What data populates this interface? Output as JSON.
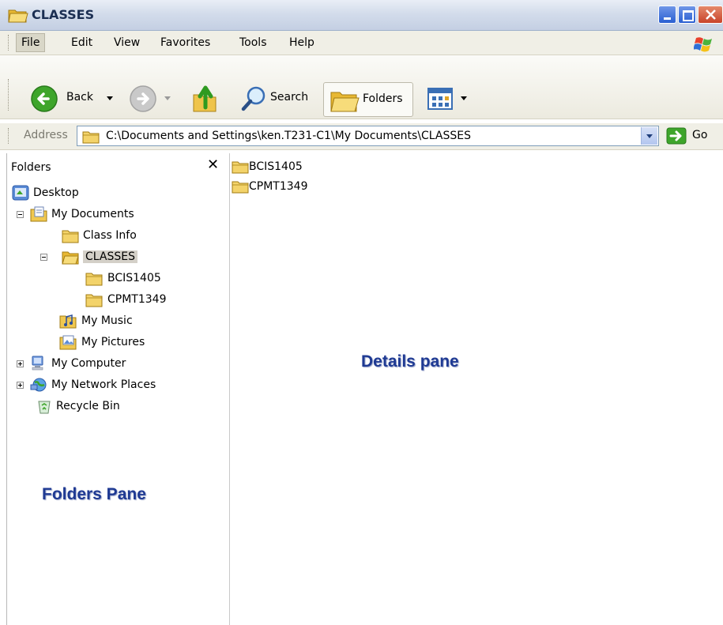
{
  "window": {
    "title": "CLASSES"
  },
  "menubar": {
    "items": [
      "File",
      "Edit",
      "View",
      "Favorites",
      "Tools",
      "Help"
    ]
  },
  "toolbar": {
    "back_label": "Back",
    "search_label": "Search",
    "folders_label": "Folders"
  },
  "address": {
    "label": "Address",
    "value": "C:\\Documents and Settings\\ken.T231-C1\\My Documents\\CLASSES",
    "go_label": "Go"
  },
  "folders_pane": {
    "header": "Folders",
    "items": [
      {
        "label": "Desktop",
        "icon": "desktop-icon"
      },
      {
        "label": "My Documents",
        "icon": "my-documents-icon",
        "expander": "minus"
      },
      {
        "label": "Class Info",
        "icon": "folder-icon"
      },
      {
        "label": "CLASSES",
        "icon": "folder-open-icon",
        "expander": "minus",
        "selected": true
      },
      {
        "label": "BCIS1405",
        "icon": "folder-icon"
      },
      {
        "label": "CPMT1349",
        "icon": "folder-icon"
      },
      {
        "label": "My Music",
        "icon": "music-folder-icon"
      },
      {
        "label": "My Pictures",
        "icon": "pictures-folder-icon"
      },
      {
        "label": "My Computer",
        "icon": "computer-icon",
        "expander": "plus"
      },
      {
        "label": "My Network Places",
        "icon": "network-icon",
        "expander": "plus"
      },
      {
        "label": "Recycle Bin",
        "icon": "recycle-bin-icon"
      }
    ]
  },
  "details": {
    "items": [
      "BCIS1405",
      "CPMT1349"
    ]
  },
  "annotations": {
    "folders_pane": "Folders Pane",
    "details_pane": "Details pane"
  },
  "colors": {
    "annotation": "#1f3a93",
    "selection": "#d4d0c8",
    "folder": "#f3d36a"
  }
}
